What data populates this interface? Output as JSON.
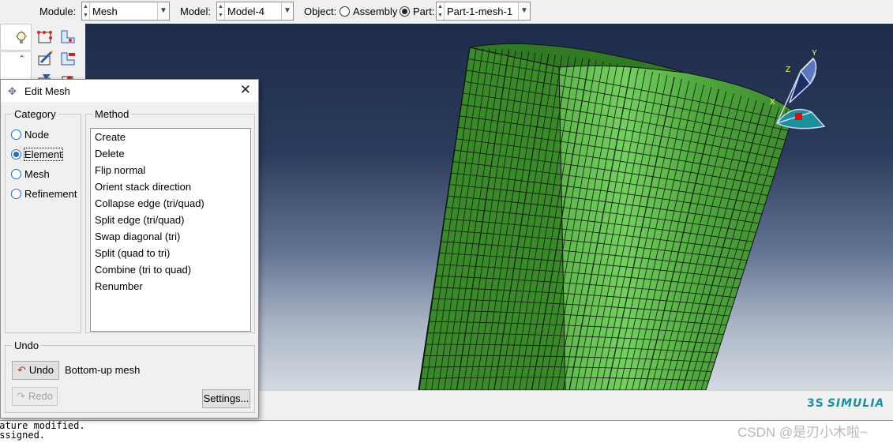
{
  "context_bar": {
    "module_label": "Module:",
    "module_value": "Mesh",
    "model_label": "Model:",
    "model_value": "Model-4",
    "object_label": "Object:",
    "assembly_label": "Assembly",
    "part_label": "Part:",
    "part_value": "Part-1-mesh-1",
    "object_selected": "Part"
  },
  "dialog": {
    "title": "Edit Mesh",
    "category": {
      "title": "Category",
      "options": [
        "Node",
        "Element",
        "Mesh",
        "Refinement"
      ],
      "selected": "Element"
    },
    "method": {
      "title": "Method",
      "items": [
        "Create",
        "Delete",
        "Flip normal",
        "Orient stack direction",
        "Collapse edge (tri/quad)",
        "Split edge (tri/quad)",
        "Swap diagonal (tri)",
        "Split (quad to tri)",
        "Combine (tri to quad)",
        "Renumber"
      ]
    },
    "undo": {
      "title": "Undo",
      "undo_label": "Undo",
      "undo_description": "Bottom-up mesh",
      "redo_label": "Redo",
      "settings_label": "Settings..."
    }
  },
  "triad": {
    "x": "X",
    "y": "Y",
    "z": "Z"
  },
  "messages": [
    "eature modified.",
    "assigned."
  ],
  "brand": {
    "name": "SIMULIA",
    "mark": "3S"
  },
  "watermark": "CSDN @是刃小木啦~",
  "colors": {
    "mesh_green": "#3f8f2e",
    "mesh_light": "#6fcf5a",
    "viewport_top": "#1e2c4b",
    "viewport_bottom": "#d4dae3",
    "brand_teal": "#1d8fa3"
  }
}
